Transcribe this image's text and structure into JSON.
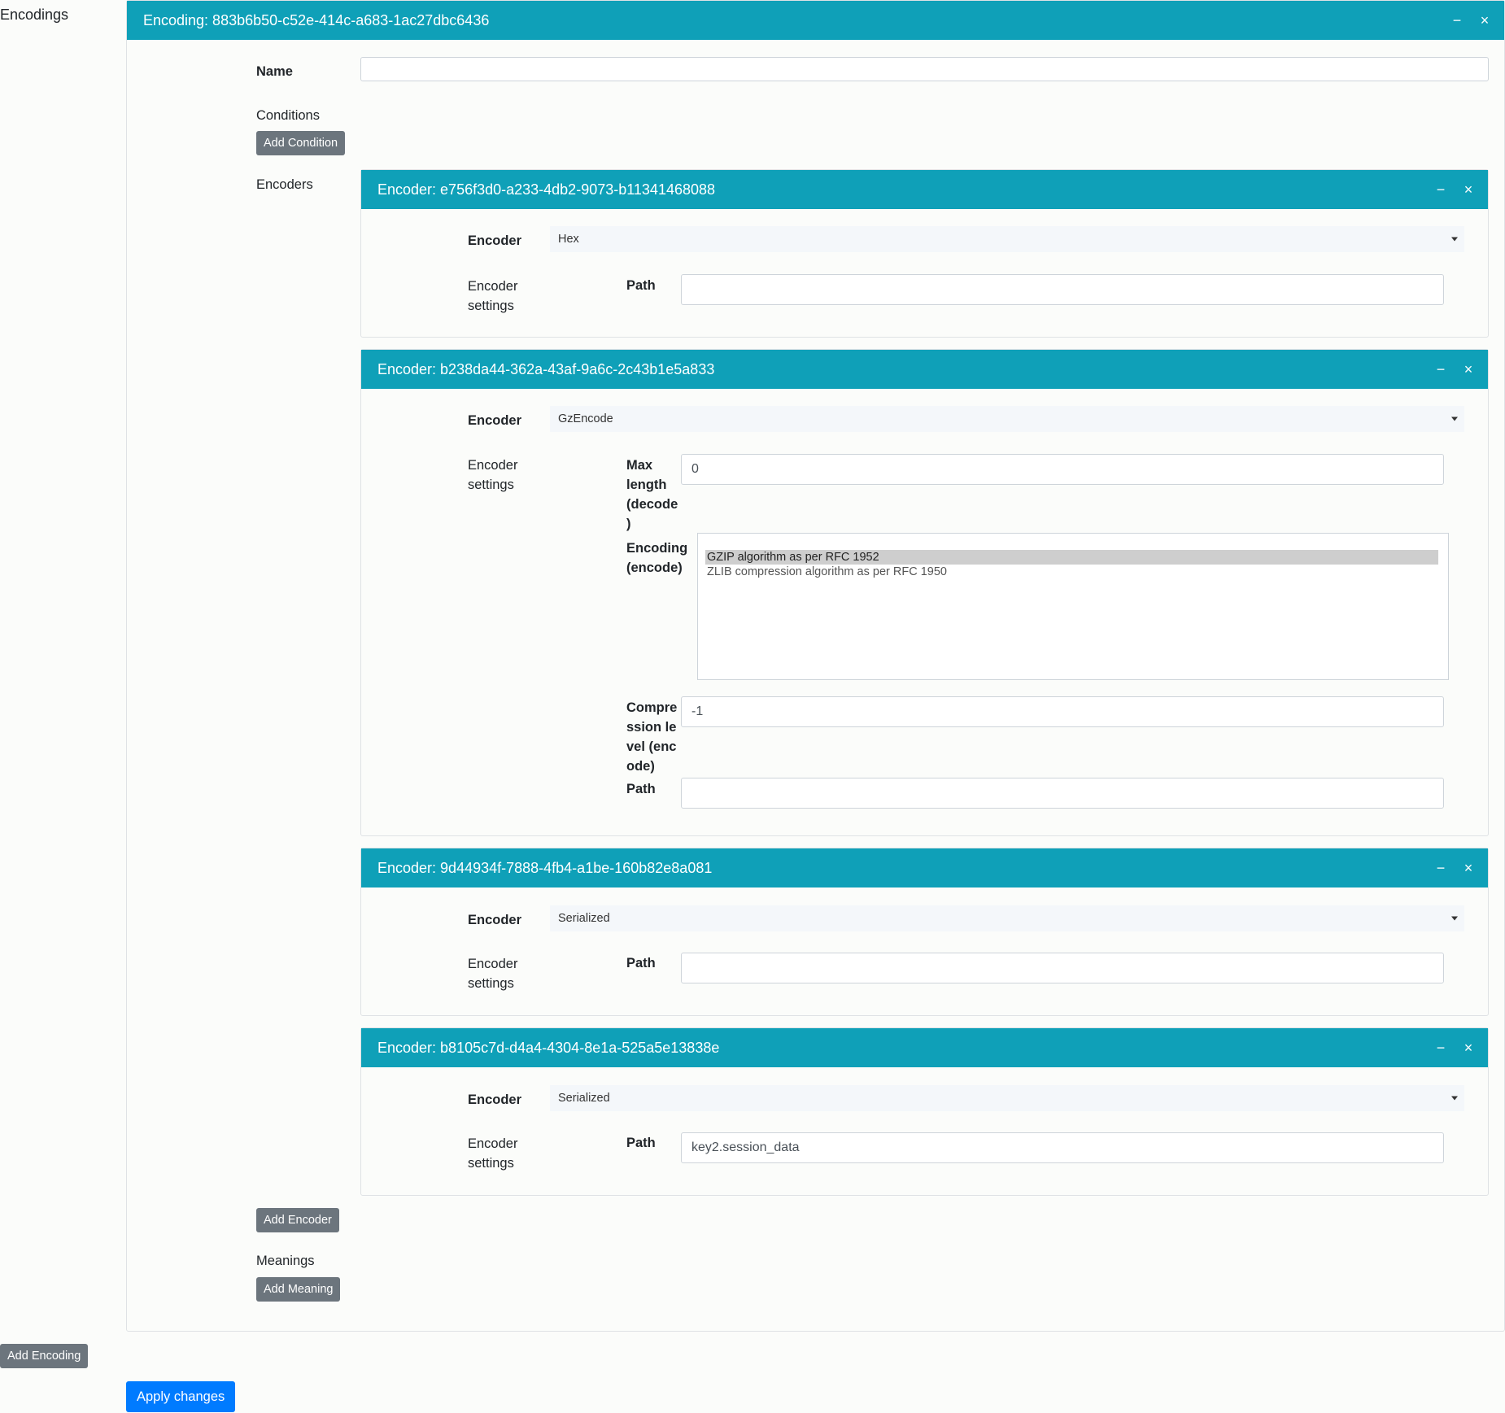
{
  "page": {
    "title": "Encodings"
  },
  "encoding": {
    "header": "Encoding: 883b6b50-c52e-414c-a683-1ac27dbc6436",
    "name_label": "Name",
    "name_value": "",
    "conditions_label": "Conditions",
    "add_condition_label": "Add Condition",
    "encoders_label": "Encoders",
    "add_encoder_label": "Add Encoder",
    "meanings_label": "Meanings",
    "add_meaning_label": "Add Meaning"
  },
  "header_icons": {
    "minimize": "−",
    "close": "×"
  },
  "labels": {
    "encoder": "Encoder",
    "encoder_settings": "Encoder settings",
    "path": "Path",
    "max_length": "Max length (decode)",
    "encoding_encode": "Encoding (encode)",
    "compression_level": "Compression level (encode)"
  },
  "encoders": [
    {
      "header": "Encoder: e756f3d0-a233-4db2-9073-b11341468088",
      "type": "Hex",
      "path": ""
    },
    {
      "header": "Encoder: b238da44-362a-43af-9a6c-2c43b1e5a833",
      "type": "GzEncode",
      "max_length": "0",
      "encoding_options": [
        "GZIP algorithm as per RFC 1952",
        "ZLIB compression algorithm as per RFC 1950"
      ],
      "encoding_selected": "GZIP algorithm as per RFC 1952",
      "compression_level": "-1",
      "path": ""
    },
    {
      "header": "Encoder: 9d44934f-7888-4fb4-a1be-160b82e8a081",
      "type": "Serialized",
      "path": ""
    },
    {
      "header": "Encoder: b8105c7d-d4a4-4304-8e1a-525a5e13838e",
      "type": "Serialized",
      "path": "key2.session_data"
    }
  ],
  "buttons": {
    "add_encoding": "Add Encoding",
    "apply_changes": "Apply changes"
  },
  "colors": {
    "header_bg": "#0fa0b8",
    "primary": "#007bff",
    "secondary": "#6c757d"
  }
}
